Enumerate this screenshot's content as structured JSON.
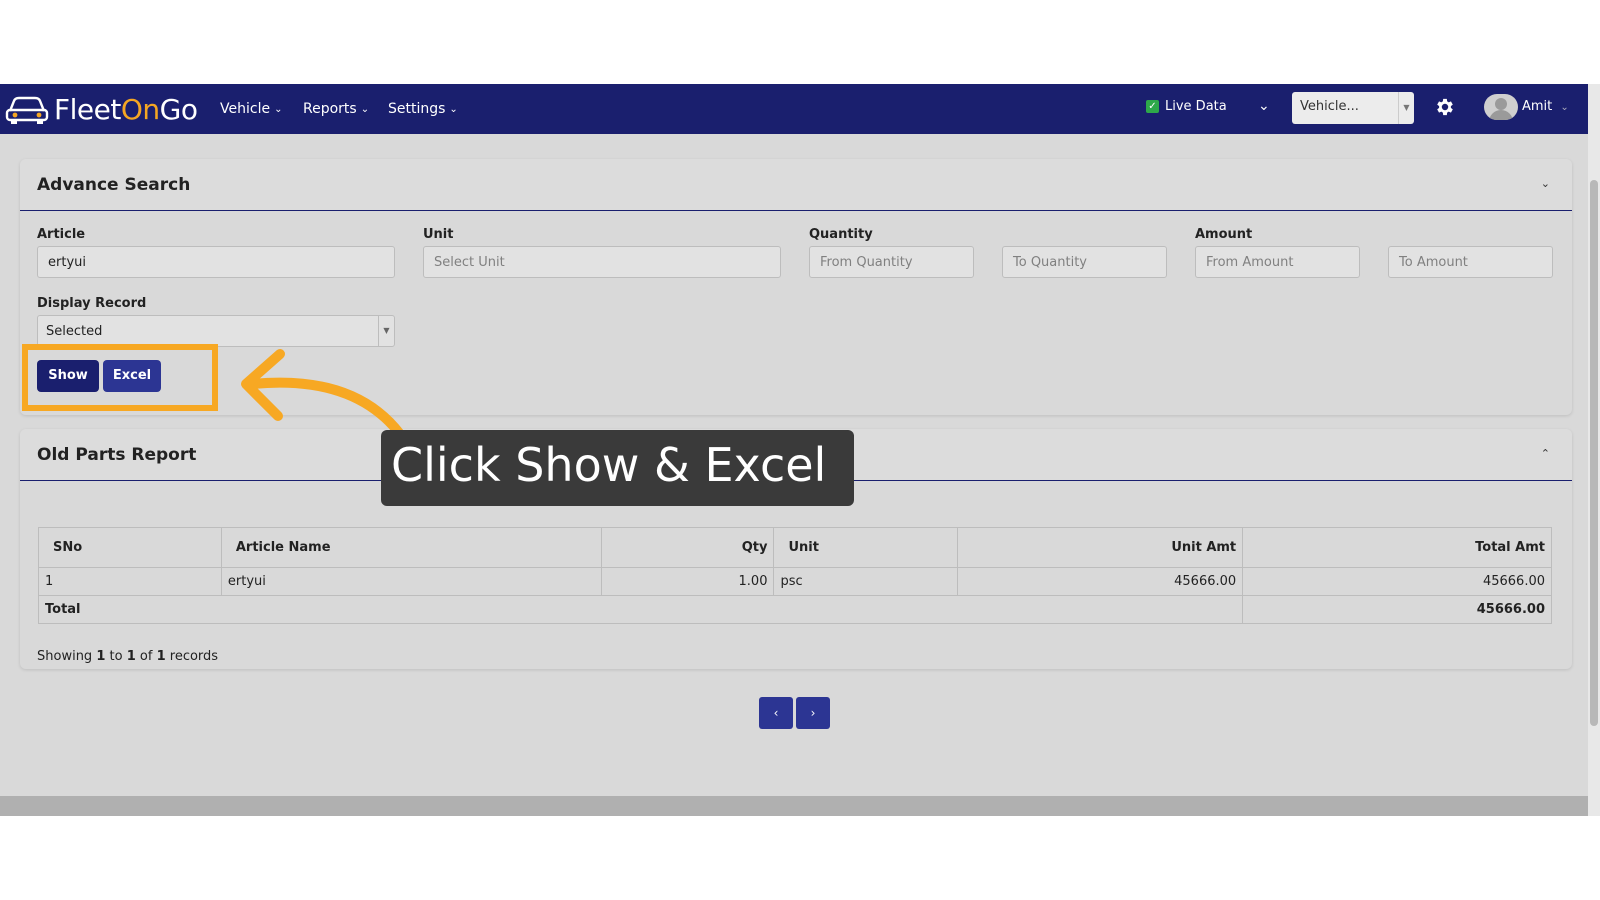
{
  "brand": {
    "name_part1": "Fleet",
    "name_part2": "On",
    "name_part3": "Go"
  },
  "nav": {
    "vehicle": "Vehicle",
    "reports": "Reports",
    "settings": "Settings"
  },
  "topbar": {
    "live_data_label": "Live Data",
    "vehicle_select_value": "Vehicle...",
    "user_name": "Amit"
  },
  "advance_search": {
    "title": "Advance Search",
    "article_label": "Article",
    "article_value": "ertyui",
    "unit_label": "Unit",
    "unit_placeholder": "Select Unit",
    "quantity_label": "Quantity",
    "from_quantity_placeholder": "From Quantity",
    "to_quantity_placeholder": "To Quantity",
    "amount_label": "Amount",
    "from_amount_placeholder": "From Amount",
    "to_amount_placeholder": "To Amount",
    "display_record_label": "Display Record",
    "display_record_value": "Selected",
    "show_label": "Show",
    "excel_label": "Excel"
  },
  "report": {
    "title": "Old Parts Report",
    "columns": [
      "SNo",
      "Article Name",
      "Qty",
      "Unit",
      "Unit Amt",
      "Total Amt"
    ],
    "rows": [
      {
        "sno": "1",
        "article": "ertyui",
        "qty": "1.00",
        "unit": "psc",
        "unit_amt": "45666.00",
        "total_amt": "45666.00"
      }
    ],
    "total_label": "Total",
    "total_value": "45666.00",
    "showing": {
      "prefix": "Showing",
      "from": "1",
      "to_word": "to",
      "to": "1",
      "of_word": "of",
      "total": "1",
      "suffix": "records"
    }
  },
  "pagination": {
    "prev": "‹",
    "next": "›"
  },
  "callout": {
    "text": "Click Show & Excel"
  },
  "colors": {
    "navbar": "#1a1f6e",
    "button": "#1a1f6e",
    "highlight": "#f7a823",
    "accent_orange": "#f5a623",
    "live_check": "#2ea84a"
  }
}
